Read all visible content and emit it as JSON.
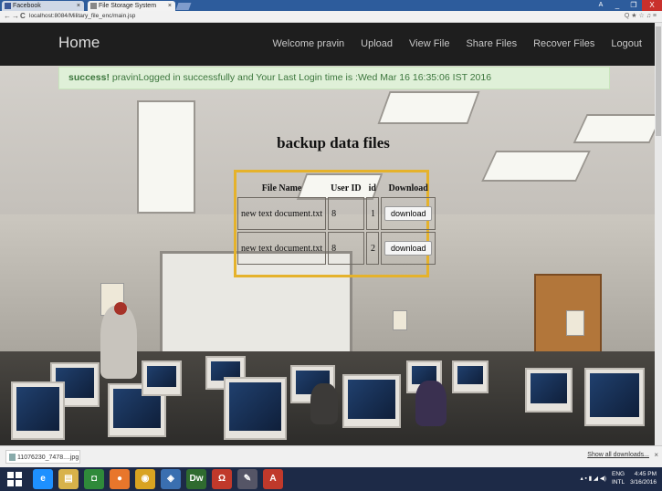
{
  "browser": {
    "tabs": [
      {
        "label": "Facebook",
        "close": "×"
      },
      {
        "label": "File Storage System",
        "close": "×"
      }
    ],
    "url": "localhost:8084/Military_file_enc/main.jsp",
    "nav": {
      "back": "←",
      "forward": "→",
      "reload": "C"
    },
    "window": {
      "user": "A",
      "minimize": "_",
      "maximize": "❐",
      "close": "X"
    },
    "addr_icons": "Q ★ ☆ ♫ ≡"
  },
  "navbar": {
    "brand": "Home",
    "links": [
      "Welcome pravin",
      "Upload",
      "View File",
      "Share Files",
      "Recover Files",
      "Logout"
    ]
  },
  "alert": {
    "strong": "success!",
    "message": " pravinLogged in successfully and Your Last Login time is :Wed Mar 16 16:35:06 IST 2016"
  },
  "content": {
    "heading": "backup data files",
    "table": {
      "headers": [
        "File Name",
        "User ID",
        "id",
        "Download"
      ],
      "rows": [
        {
          "file_name": "new text document.txt",
          "user_id": "8",
          "id": "1",
          "action": "download"
        },
        {
          "file_name": "new text document.txt",
          "user_id": "8",
          "id": "2",
          "action": "download"
        }
      ]
    }
  },
  "downloads": {
    "item": "11076230_7478....jpg",
    "show_all": "Show all downloads...",
    "close": "×"
  },
  "taskbar": {
    "apps": [
      {
        "name": "ie-icon",
        "glyph": "e",
        "color": "#1e90ff"
      },
      {
        "name": "explorer-icon",
        "glyph": "▤",
        "color": "#d8b24a"
      },
      {
        "name": "store-icon",
        "glyph": "◘",
        "color": "#2f8a3a"
      },
      {
        "name": "firefox-icon",
        "glyph": "●",
        "color": "#e8762b"
      },
      {
        "name": "chrome-icon",
        "glyph": "◉",
        "color": "#d9a321"
      },
      {
        "name": "netbeans-icon",
        "glyph": "◈",
        "color": "#3a6fb0"
      },
      {
        "name": "dreamweaver-icon",
        "glyph": "Dw",
        "color": "#2f6b2f"
      },
      {
        "name": "headphones-icon",
        "glyph": "Ω",
        "color": "#c0392b"
      },
      {
        "name": "paint-icon",
        "glyph": "✎",
        "color": "#556"
      },
      {
        "name": "acrobat-icon",
        "glyph": "A",
        "color": "#c0392b"
      }
    ],
    "lang": [
      "ENG",
      "INTL"
    ],
    "clock": [
      "4:45 PM",
      "3/16/2016"
    ]
  }
}
